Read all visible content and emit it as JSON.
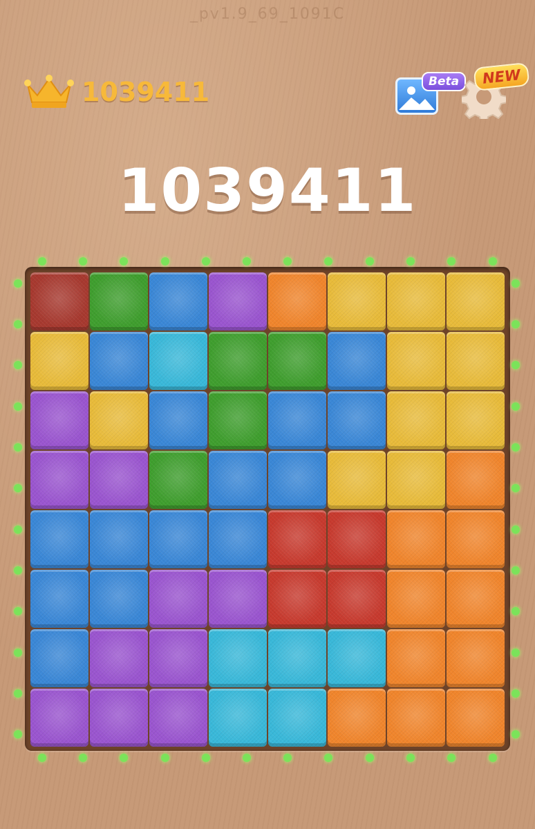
{
  "version_text": "_pv1.9_69_1091C",
  "best_score": "1039411",
  "current_score": "1039411",
  "badges": {
    "gallery": "Beta",
    "settings": "NEW"
  },
  "icons": {
    "best": "crown-icon",
    "gallery": "gallery-icon",
    "settings": "gear-icon"
  },
  "colors": {
    "R": "#c73a2e",
    "G": "#3f9e2e",
    "B": "#3a87d6",
    "P": "#9a55cf",
    "O": "#f0852c",
    "Y": "#e8bb3a",
    "C": "#39b8d9",
    "D": "#a7392f",
    "highlight_dot": "#7be35a"
  },
  "board": {
    "rows": 8,
    "cols": 8,
    "cells": [
      [
        "D",
        "G",
        "B",
        "P",
        "O",
        "Y",
        "Y",
        "Y"
      ],
      [
        "Y",
        "B",
        "C",
        "G",
        "G",
        "B",
        "Y",
        "Y"
      ],
      [
        "P",
        "Y",
        "B",
        "G",
        "B",
        "B",
        "Y",
        "Y"
      ],
      [
        "P",
        "P",
        "G",
        "B",
        "B",
        "Y",
        "Y",
        "O"
      ],
      [
        "B",
        "B",
        "B",
        "B",
        "R",
        "R",
        "O",
        "O"
      ],
      [
        "B",
        "B",
        "P",
        "P",
        "R",
        "R",
        "O",
        "O"
      ],
      [
        "B",
        "P",
        "P",
        "C",
        "C",
        "C",
        "O",
        "O"
      ],
      [
        "P",
        "P",
        "P",
        "C",
        "C",
        "O",
        "O",
        "O"
      ]
    ]
  }
}
